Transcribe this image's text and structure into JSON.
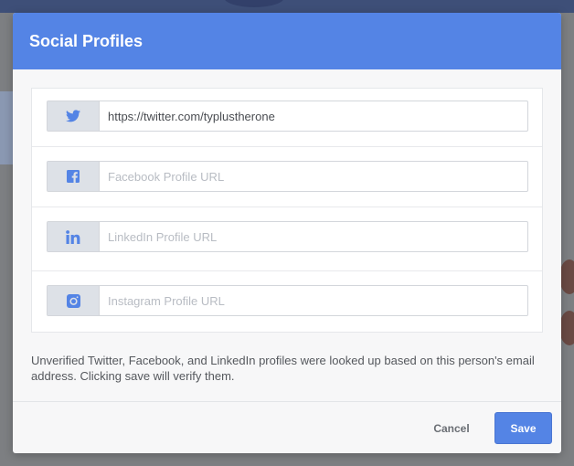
{
  "modal": {
    "title": "Social Profiles"
  },
  "profiles": [
    {
      "network": "twitter",
      "icon": "twitter-icon",
      "value": "https://twitter.com/typlustherone",
      "placeholder": ""
    },
    {
      "network": "facebook",
      "icon": "facebook-icon",
      "value": "",
      "placeholder": "Facebook Profile URL"
    },
    {
      "network": "linkedin",
      "icon": "linkedin-icon",
      "value": "",
      "placeholder": "LinkedIn Profile URL"
    },
    {
      "network": "instagram",
      "icon": "instagram-icon",
      "value": "",
      "placeholder": "Instagram Profile URL"
    }
  ],
  "note": "Unverified Twitter, Facebook, and LinkedIn profiles were looked up based on this person's email address. Clicking save will verify them.",
  "footer": {
    "cancel_label": "Cancel",
    "save_label": "Save"
  },
  "colors": {
    "accent": "#5484e5",
    "icon": "#5484e5"
  }
}
